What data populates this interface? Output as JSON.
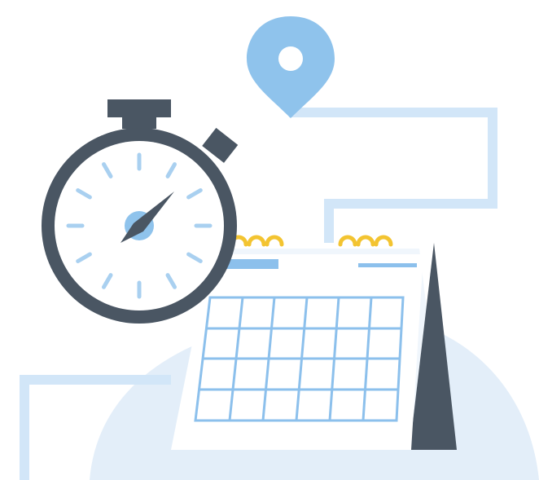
{
  "illustration": {
    "icons": [
      "stopwatch-icon",
      "calendar-icon",
      "location-pin-icon",
      "route-path"
    ],
    "colors": {
      "background_blob": "#e3eef9",
      "route_line": "#d2e6f8",
      "pin_blue": "#8fc3ec",
      "stopwatch_dark": "#4a5663",
      "stopwatch_ticks": "#a9d0f0",
      "calendar_grid": "#8cc0ec",
      "calendar_page": "#ffffff",
      "rings_gold": "#f3c431",
      "shadow_dark": "#4a5663"
    }
  }
}
